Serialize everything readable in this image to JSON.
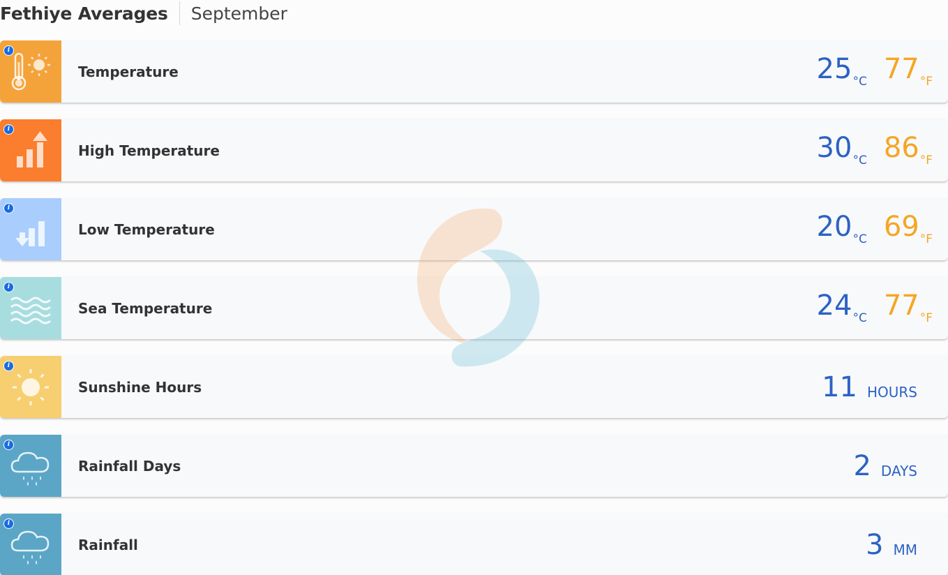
{
  "header": {
    "title": "Fethiye Averages",
    "month": "September"
  },
  "info_glyph": "i",
  "rows": [
    {
      "label": "Temperature",
      "icon": "thermometer-sun-icon",
      "icon_bg": "#f4a33a",
      "c": "25",
      "c_unit": "°C",
      "f": "77",
      "f_unit": "°F"
    },
    {
      "label": "High Temperature",
      "icon": "bars-up-arrow-icon",
      "icon_bg": "#fb7d2e",
      "c": "30",
      "c_unit": "°C",
      "f": "86",
      "f_unit": "°F"
    },
    {
      "label": "Low Temperature",
      "icon": "bars-down-arrow-icon",
      "icon_bg": "#a9cdfc",
      "c": "20",
      "c_unit": "°C",
      "f": "69",
      "f_unit": "°F"
    },
    {
      "label": "Sea Temperature",
      "icon": "waves-icon",
      "icon_bg": "#a8dde0",
      "c": "24",
      "c_unit": "°C",
      "f": "77",
      "f_unit": "°F"
    },
    {
      "label": "Sunshine Hours",
      "icon": "sun-icon",
      "icon_bg": "#f7cf70",
      "value": "11",
      "unit": "HOURS"
    },
    {
      "label": "Rainfall Days",
      "icon": "rain-cloud-icon",
      "icon_bg": "#5ba6c6",
      "value": "2",
      "unit": "DAYS"
    },
    {
      "label": "Rainfall",
      "icon": "rain-cloud-icon",
      "icon_bg": "#5ba6c6",
      "value": "3",
      "unit": "MM"
    }
  ],
  "colors": {
    "celsius": "#2c62c4",
    "fahrenheit": "#f5a623",
    "label": "#333333"
  }
}
